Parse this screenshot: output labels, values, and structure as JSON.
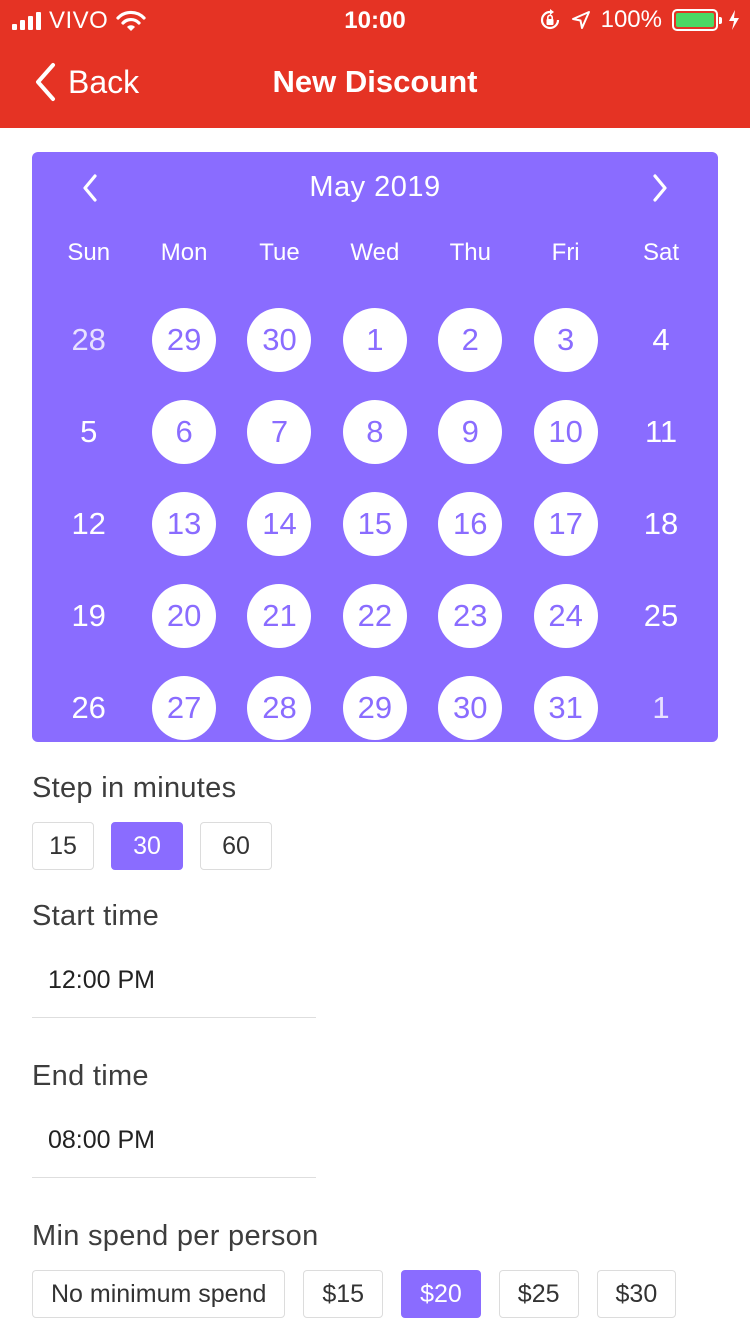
{
  "status_bar": {
    "carrier": "VIVO",
    "time": "10:00",
    "battery_pct": "100%",
    "battery_level": 1.0,
    "battery_color": "#4cd964"
  },
  "nav": {
    "back_label": "Back",
    "title": "New Discount"
  },
  "colors": {
    "header": "#e53324",
    "accent": "#8a6cff"
  },
  "calendar": {
    "month_label": "May 2019",
    "weekdays": [
      "Sun",
      "Mon",
      "Tue",
      "Wed",
      "Thu",
      "Fri",
      "Sat"
    ],
    "days": [
      {
        "label": "28",
        "available": false,
        "muted": true
      },
      {
        "label": "29",
        "available": true
      },
      {
        "label": "30",
        "available": true
      },
      {
        "label": "1",
        "available": true
      },
      {
        "label": "2",
        "available": true
      },
      {
        "label": "3",
        "available": true
      },
      {
        "label": "4",
        "available": false
      },
      {
        "label": "5",
        "available": false
      },
      {
        "label": "6",
        "available": true
      },
      {
        "label": "7",
        "available": true
      },
      {
        "label": "8",
        "available": true
      },
      {
        "label": "9",
        "available": true
      },
      {
        "label": "10",
        "available": true
      },
      {
        "label": "11",
        "available": false
      },
      {
        "label": "12",
        "available": false
      },
      {
        "label": "13",
        "available": true
      },
      {
        "label": "14",
        "available": true
      },
      {
        "label": "15",
        "available": true
      },
      {
        "label": "16",
        "available": true
      },
      {
        "label": "17",
        "available": true
      },
      {
        "label": "18",
        "available": false
      },
      {
        "label": "19",
        "available": false
      },
      {
        "label": "20",
        "available": true
      },
      {
        "label": "21",
        "available": true
      },
      {
        "label": "22",
        "available": true
      },
      {
        "label": "23",
        "available": true
      },
      {
        "label": "24",
        "available": true
      },
      {
        "label": "25",
        "available": false
      },
      {
        "label": "26",
        "available": false
      },
      {
        "label": "27",
        "available": true
      },
      {
        "label": "28",
        "available": true
      },
      {
        "label": "29",
        "available": true
      },
      {
        "label": "30",
        "available": true
      },
      {
        "label": "31",
        "available": true
      },
      {
        "label": "1",
        "available": false,
        "muted": true
      }
    ]
  },
  "step": {
    "label": "Step in minutes",
    "options": [
      {
        "label": "15",
        "selected": false
      },
      {
        "label": "30",
        "selected": true
      },
      {
        "label": "60",
        "selected": false
      }
    ]
  },
  "start_time": {
    "label": "Start time",
    "value": "12:00 PM"
  },
  "end_time": {
    "label": "End time",
    "value": "08:00 PM"
  },
  "min_spend": {
    "label": "Min spend per person",
    "options": [
      {
        "label": "No minimum spend",
        "selected": false
      },
      {
        "label": "$15",
        "selected": false
      },
      {
        "label": "$20",
        "selected": true
      },
      {
        "label": "$25",
        "selected": false
      },
      {
        "label": "$30",
        "selected": false
      }
    ]
  }
}
